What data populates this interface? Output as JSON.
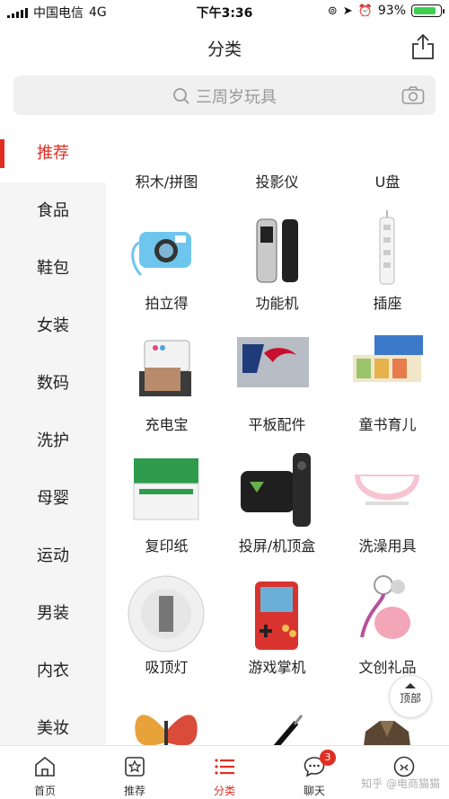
{
  "status_bar": {
    "carrier": "中国电信",
    "network": "4G",
    "time": "下午3:36",
    "battery": "93%",
    "battery_level": 0.93
  },
  "nav": {
    "title": "分类"
  },
  "search": {
    "placeholder": "三周岁玩具"
  },
  "sidebar": {
    "items": [
      {
        "label": "推荐",
        "active": true
      },
      {
        "label": "食品"
      },
      {
        "label": "鞋包"
      },
      {
        "label": "女装"
      },
      {
        "label": "数码"
      },
      {
        "label": "洗护"
      },
      {
        "label": "母婴"
      },
      {
        "label": "运动"
      },
      {
        "label": "男装"
      },
      {
        "label": "内衣"
      },
      {
        "label": "美妆"
      }
    ]
  },
  "categories": [
    {
      "label": "积木/拼图",
      "icon": "puzzle-blocks"
    },
    {
      "label": "投影仪",
      "icon": "projector"
    },
    {
      "label": "U盘",
      "icon": "usb-drive"
    },
    {
      "label": "拍立得",
      "icon": "instant-camera"
    },
    {
      "label": "功能机",
      "icon": "feature-phone"
    },
    {
      "label": "插座",
      "icon": "power-strip"
    },
    {
      "label": "充电宝",
      "icon": "photo-printer"
    },
    {
      "label": "平板配件",
      "icon": "tablet-cover"
    },
    {
      "label": "童书育儿",
      "icon": "book-set"
    },
    {
      "label": "复印纸",
      "icon": "copy-paper-box"
    },
    {
      "label": "投屏/机顶盒",
      "icon": "tv-box"
    },
    {
      "label": "洗澡用具",
      "icon": "baby-bathtub"
    },
    {
      "label": "吸顶灯",
      "icon": "ceiling-lamp"
    },
    {
      "label": "游戏掌机",
      "icon": "handheld-console"
    },
    {
      "label": "文创礼品",
      "icon": "keychain-charm"
    },
    {
      "label": "",
      "icon": "butterfly-kite"
    },
    {
      "label": "",
      "icon": "pen"
    },
    {
      "label": "",
      "icon": "jacket"
    }
  ],
  "top_button": {
    "label": "顶部"
  },
  "tabbar": {
    "items": [
      {
        "label": "首页",
        "icon": "home-icon"
      },
      {
        "label": "推荐",
        "icon": "star-icon"
      },
      {
        "label": "分类",
        "icon": "list-icon",
        "active": true
      },
      {
        "label": "聊天",
        "icon": "chat-icon",
        "badge": "3"
      },
      {
        "label": "",
        "icon": "more-icon"
      }
    ]
  },
  "watermark": "知乎 @电商猫猫",
  "colors": {
    "accent": "#e02e24",
    "sidebar_bg": "#f5f5f5",
    "search_bg": "#f0f0f0"
  }
}
